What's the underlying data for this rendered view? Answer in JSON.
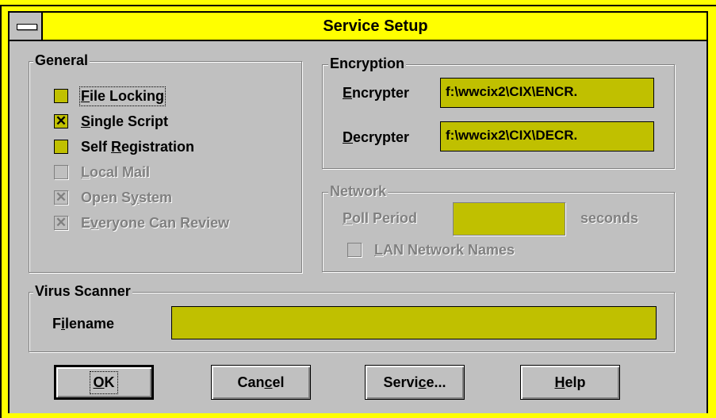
{
  "window": {
    "title": "Service Setup"
  },
  "general": {
    "legend": "General",
    "items": [
      {
        "pre": "",
        "key": "F",
        "post": "ile Locking",
        "checked": false,
        "enabled": true
      },
      {
        "pre": "",
        "key": "S",
        "post": "ingle Script",
        "checked": true,
        "enabled": true
      },
      {
        "pre": "Self ",
        "key": "R",
        "post": "egistration",
        "checked": false,
        "enabled": true
      },
      {
        "pre": "",
        "key": "L",
        "post": "ocal Mail",
        "checked": false,
        "enabled": false
      },
      {
        "pre": "Open S",
        "key": "y",
        "post": "stem",
        "checked": true,
        "enabled": false
      },
      {
        "pre": "E",
        "key": "v",
        "post": "eryone Can Review",
        "checked": true,
        "enabled": false
      }
    ]
  },
  "encryption": {
    "legend": "Encryption",
    "encrypter": {
      "key": "E",
      "rest": "ncrypter",
      "value": "f:\\wwcix2\\CIX\\ENCR."
    },
    "decrypter": {
      "key": "D",
      "rest": "ecrypter",
      "value": "f:\\wwcix2\\CIX\\DECR."
    }
  },
  "network": {
    "legend": "Network",
    "poll": {
      "key": "P",
      "rest": "oll Period",
      "value": "",
      "unit": "seconds"
    },
    "lan": {
      "key": "L",
      "rest": "AN Network Names",
      "checked": false
    }
  },
  "virus": {
    "legend": "Virus Scanner",
    "filename": {
      "pre": "F",
      "key": "i",
      "post": "lename",
      "value": ""
    }
  },
  "buttons": {
    "ok": {
      "key": "O",
      "rest": "K"
    },
    "cancel": {
      "pre": "Can",
      "key": "c",
      "post": "el"
    },
    "service": {
      "pre": "Servi",
      "key": "c",
      "post": "e..."
    },
    "help": {
      "key": "H",
      "rest": "elp"
    }
  }
}
